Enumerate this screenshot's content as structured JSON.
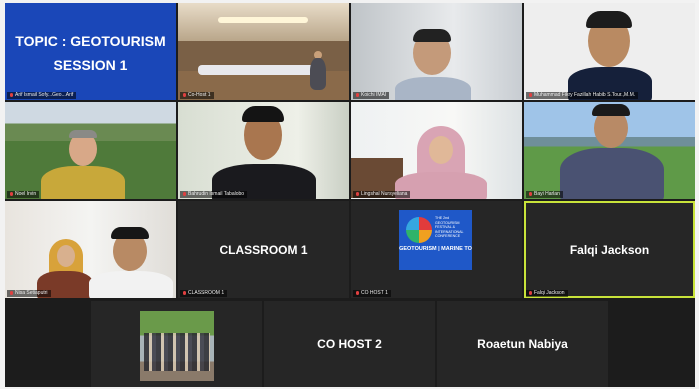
{
  "slide": {
    "line1": "TOPIC : GEOTOURISM",
    "line2": "SESSION 1"
  },
  "tiles": {
    "slide_caption": "Arif Ismail Sofy...Geo...Arif",
    "room_caption": "Co-Host 1",
    "p3_caption": "Koichi IMAI",
    "p4_caption": "Muhammad Fikry Fazillah Habib S.Tour.,M.M.",
    "p5_caption": "Noel Irvin",
    "p6_caption": "Bahrudin Ismail Tabalobo",
    "p7_caption": "Lingshal Nursyeliana",
    "p8_caption": "Bayi Harlan",
    "p9_caption": "Nisa Setiaputri",
    "classroom": {
      "name": "CLASSROOM 1",
      "caption": "CLASSROOM 1"
    },
    "cohost1_caption": "CO HOST 1",
    "falqi": {
      "name": "Falqi Jackson",
      "caption": "Falqi Jackson"
    },
    "cohost2": {
      "name": "CO HOST 2"
    },
    "roaetun": {
      "name": "Roaetun Nabiya"
    }
  },
  "logo": {
    "text": "THE 2nd GEOTOURISM FESTIVAL & INTERNATIONAL CONFERENCE",
    "band": "GEOTOURISM | MARINE TO"
  },
  "colors": {
    "active_speaker": "#c8e33a",
    "slide_bg": "#1a47b8"
  }
}
